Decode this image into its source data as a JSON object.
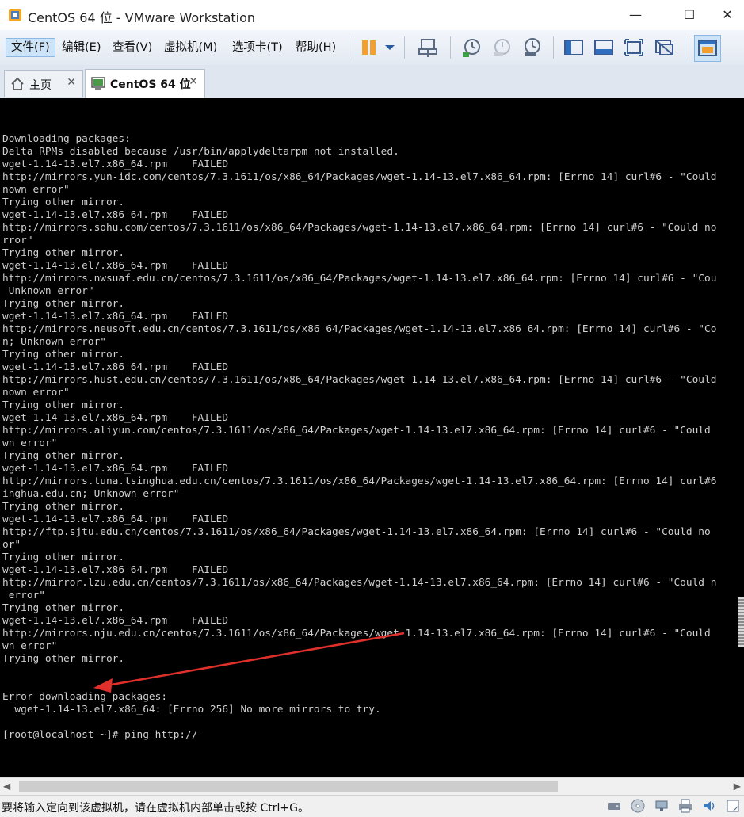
{
  "window": {
    "title": "CentOS 64 位 - VMware Workstation",
    "minimize": "—",
    "maximize": "☐",
    "close": "✕"
  },
  "menu": [
    "文件(F)",
    "编辑(E)",
    "查看(V)",
    "虚拟机(M)",
    "选项卡(T)",
    "帮助(H)"
  ],
  "tabs": [
    {
      "label": "主页",
      "close": "✕"
    },
    {
      "label": "CentOS 64 位",
      "close": "✕"
    }
  ],
  "console": {
    "lines": [
      "Downloading packages:",
      "Delta RPMs disabled because /usr/bin/applydeltarpm not installed.",
      "wget-1.14-13.el7.x86_64.rpm    FAILED",
      "http://mirrors.yun-idc.com/centos/7.3.1611/os/x86_64/Packages/wget-1.14-13.el7.x86_64.rpm: [Errno 14] curl#6 - \"Could",
      "nown error\"",
      "Trying other mirror.",
      "wget-1.14-13.el7.x86_64.rpm    FAILED",
      "http://mirrors.sohu.com/centos/7.3.1611/os/x86_64/Packages/wget-1.14-13.el7.x86_64.rpm: [Errno 14] curl#6 - \"Could no",
      "rror\"",
      "Trying other mirror.",
      "wget-1.14-13.el7.x86_64.rpm    FAILED",
      "http://mirrors.nwsuaf.edu.cn/centos/7.3.1611/os/x86_64/Packages/wget-1.14-13.el7.x86_64.rpm: [Errno 14] curl#6 - \"Cou",
      " Unknown error\"",
      "Trying other mirror.",
      "wget-1.14-13.el7.x86_64.rpm    FAILED",
      "http://mirrors.neusoft.edu.cn/centos/7.3.1611/os/x86_64/Packages/wget-1.14-13.el7.x86_64.rpm: [Errno 14] curl#6 - \"Co",
      "n; Unknown error\"",
      "Trying other mirror.",
      "wget-1.14-13.el7.x86_64.rpm    FAILED",
      "http://mirrors.hust.edu.cn/centos/7.3.1611/os/x86_64/Packages/wget-1.14-13.el7.x86_64.rpm: [Errno 14] curl#6 - \"Could",
      "nown error\"",
      "Trying other mirror.",
      "wget-1.14-13.el7.x86_64.rpm    FAILED",
      "http://mirrors.aliyun.com/centos/7.3.1611/os/x86_64/Packages/wget-1.14-13.el7.x86_64.rpm: [Errno 14] curl#6 - \"Could",
      "wn error\"",
      "Trying other mirror.",
      "wget-1.14-13.el7.x86_64.rpm    FAILED",
      "http://mirrors.tuna.tsinghua.edu.cn/centos/7.3.1611/os/x86_64/Packages/wget-1.14-13.el7.x86_64.rpm: [Errno 14] curl#6",
      "inghua.edu.cn; Unknown error\"",
      "Trying other mirror.",
      "wget-1.14-13.el7.x86_64.rpm    FAILED",
      "http://ftp.sjtu.edu.cn/centos/7.3.1611/os/x86_64/Packages/wget-1.14-13.el7.x86_64.rpm: [Errno 14] curl#6 - \"Could no",
      "or\"",
      "Trying other mirror.",
      "wget-1.14-13.el7.x86_64.rpm    FAILED",
      "http://mirror.lzu.edu.cn/centos/7.3.1611/os/x86_64/Packages/wget-1.14-13.el7.x86_64.rpm: [Errno 14] curl#6 - \"Could n",
      " error\"",
      "Trying other mirror.",
      "wget-1.14-13.el7.x86_64.rpm    FAILED",
      "http://mirrors.nju.edu.cn/centos/7.3.1611/os/x86_64/Packages/wget-1.14-13.el7.x86_64.rpm: [Errno 14] curl#6 - \"Could",
      "wn error\"",
      "Trying other mirror.",
      "",
      "",
      "Error downloading packages:",
      "  wget-1.14-13.el7.x86_64: [Errno 256] No more mirrors to try.",
      "",
      "[root@localhost ~]# ping http://"
    ]
  },
  "status": {
    "message": "要将输入定向到该虚拟机，请在虚拟机内部单击或按 Ctrl+G。"
  },
  "colors": {
    "arrow": "#e0302c",
    "console_bg": "#000000",
    "console_text": "#d0d0d0"
  }
}
